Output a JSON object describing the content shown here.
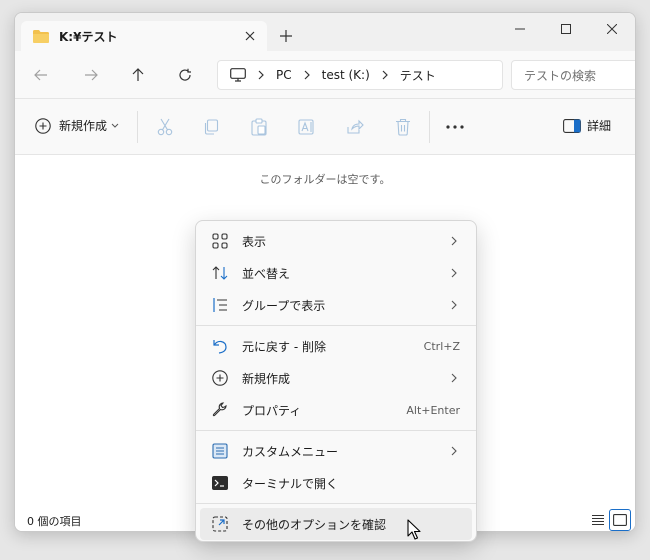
{
  "window": {
    "tab_title": "K:¥テスト",
    "icons": {
      "folder": "folder-icon",
      "close_tab": "close-icon",
      "new_tab": "plus-icon",
      "minimize": "minimize-icon",
      "maximize": "maximize-icon",
      "close_window": "close-icon"
    }
  },
  "nav": {
    "back_icon": "arrow-left-icon",
    "forward_icon": "arrow-right-icon",
    "up_icon": "arrow-up-icon",
    "refresh_icon": "refresh-icon",
    "breadcrumb": [
      "PC",
      "test (K:)",
      "テスト"
    ],
    "search_placeholder": "テストの検索"
  },
  "toolbar": {
    "new_label": "新規作成",
    "details_label": "詳細",
    "more_icon": "more-icon"
  },
  "content": {
    "empty_message": "このフォルダーは空です。"
  },
  "status": {
    "item_count": "0 個の項目"
  },
  "context_menu": {
    "items": [
      {
        "label": "表示",
        "icon": "grid-icon",
        "submenu": true
      },
      {
        "label": "並べ替え",
        "icon": "sort-icon",
        "submenu": true
      },
      {
        "label": "グループで表示",
        "icon": "group-icon",
        "submenu": true
      },
      {
        "label": "元に戻す - 削除",
        "icon": "undo-icon",
        "shortcut": "Ctrl+Z"
      },
      {
        "label": "新規作成",
        "icon": "plus-circle-icon",
        "submenu": true
      },
      {
        "label": "プロパティ",
        "icon": "wrench-icon",
        "shortcut": "Alt+Enter"
      },
      {
        "label": "カスタムメニュー",
        "icon": "custom-menu-icon",
        "submenu": true
      },
      {
        "label": "ターミナルで開く",
        "icon": "terminal-icon"
      },
      {
        "label": "その他のオプションを確認",
        "icon": "open-external-icon"
      }
    ]
  },
  "colors": {
    "accent": "#1a6ec8",
    "folder": "#f2c14e",
    "disabled_icon": "#a9c4de"
  }
}
